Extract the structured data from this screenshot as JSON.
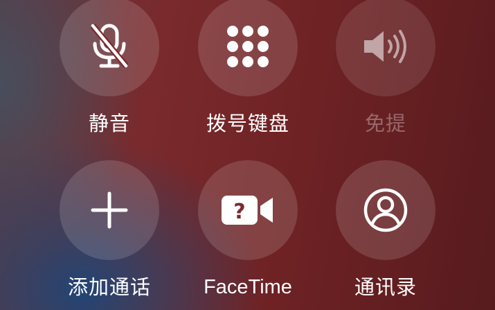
{
  "call_controls": {
    "mute": {
      "label": "静音",
      "icon": "microphone-slash-icon"
    },
    "keypad": {
      "label": "拨号键盘",
      "icon": "keypad-grid-icon"
    },
    "speaker": {
      "label": "免提",
      "icon": "speaker-wave-icon",
      "state": "disabled"
    },
    "add_call": {
      "label": "添加通话",
      "icon": "plus-icon"
    },
    "facetime": {
      "label": "FaceTime",
      "icon": "video-question-icon"
    },
    "contacts": {
      "label": "通讯录",
      "icon": "person-circle-icon"
    }
  },
  "colors": {
    "background_red": "#6e2224",
    "background_blue": "#1e4678",
    "icon_white": "#ffffff",
    "disabled_text": "#b58b8c"
  }
}
